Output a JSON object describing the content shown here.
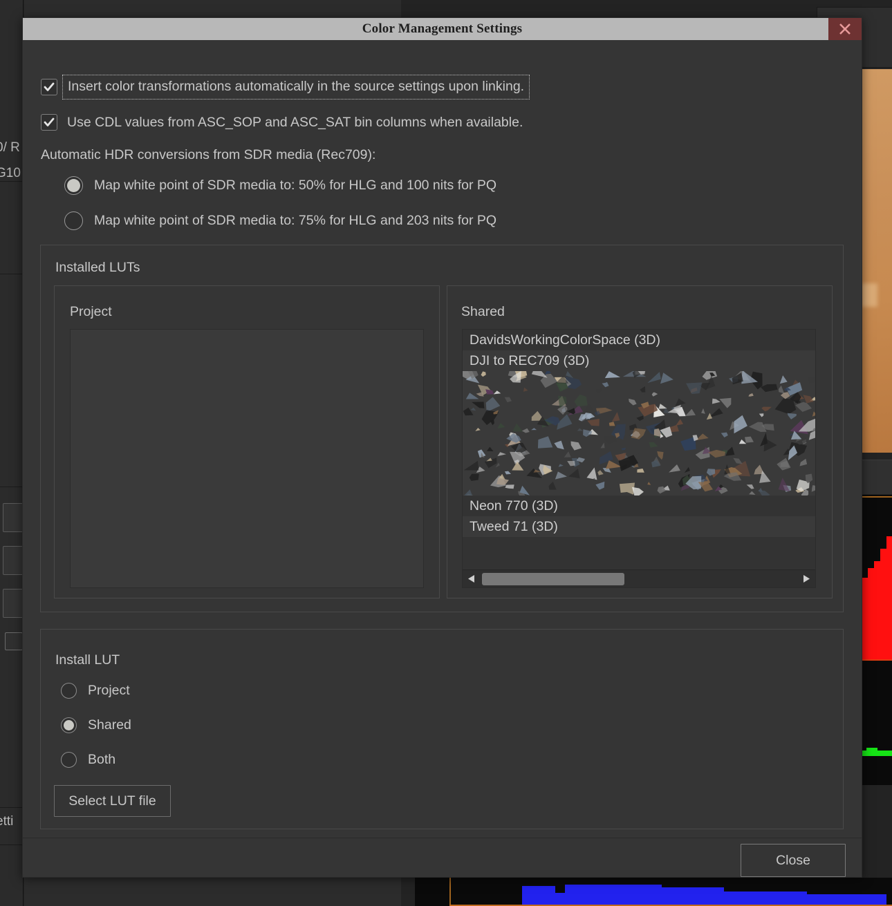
{
  "dialog": {
    "title": "Color Management Settings",
    "close_icon": "close-x-icon",
    "checkboxes": [
      {
        "label": "Insert color transformations automatically in the source settings upon linking.",
        "checked": true,
        "focused": true
      },
      {
        "label": "Use CDL values from ASC_SOP and ASC_SAT bin columns when available.",
        "checked": true,
        "focused": false
      }
    ],
    "hdr_section": {
      "label": "Automatic HDR conversions from SDR media (Rec709):",
      "options": [
        {
          "label": "Map white point of SDR media to: 50% for HLG and 100 nits for PQ",
          "selected": true
        },
        {
          "label": "Map white point of SDR media to: 75% for HLG and 203 nits for PQ",
          "selected": false
        }
      ]
    },
    "installed_luts": {
      "title": "Installed LUTs",
      "project": {
        "title": "Project",
        "items": []
      },
      "shared": {
        "title": "Shared",
        "items": [
          "DavidsWorkingColorSpace (3D)",
          "DJI to REC709 (3D)",
          "Neon 770 (3D)",
          "Tweed 71 (3D)"
        ],
        "scrollbar": {
          "left_arrow_icon": "triangle-left-icon",
          "right_arrow_icon": "triangle-right-icon",
          "thumb_fraction": 0.45
        }
      }
    },
    "install_lut": {
      "title": "Install LUT",
      "options": [
        {
          "label": "Project",
          "selected": false
        },
        {
          "label": "Shared",
          "selected": true
        },
        {
          "label": "Both",
          "selected": false
        }
      ],
      "select_file_button": "Select LUT file"
    },
    "close_button": "Close"
  },
  "background": {
    "left_panel": {
      "text_fragments": [
        "0/ R",
        "G10",
        "etti"
      ]
    },
    "scopes": {
      "channels": [
        "red",
        "green",
        "blue"
      ]
    }
  },
  "colors": {
    "titlebar_bg": "#b8b8b8",
    "dialog_bg": "#353535",
    "text": "#c8c8c8",
    "close_bg": "#6e3232",
    "accent_thumb": "#787878",
    "scope_red": "#ff1010",
    "scope_green": "#16e416",
    "scope_blue": "#2222ee"
  }
}
